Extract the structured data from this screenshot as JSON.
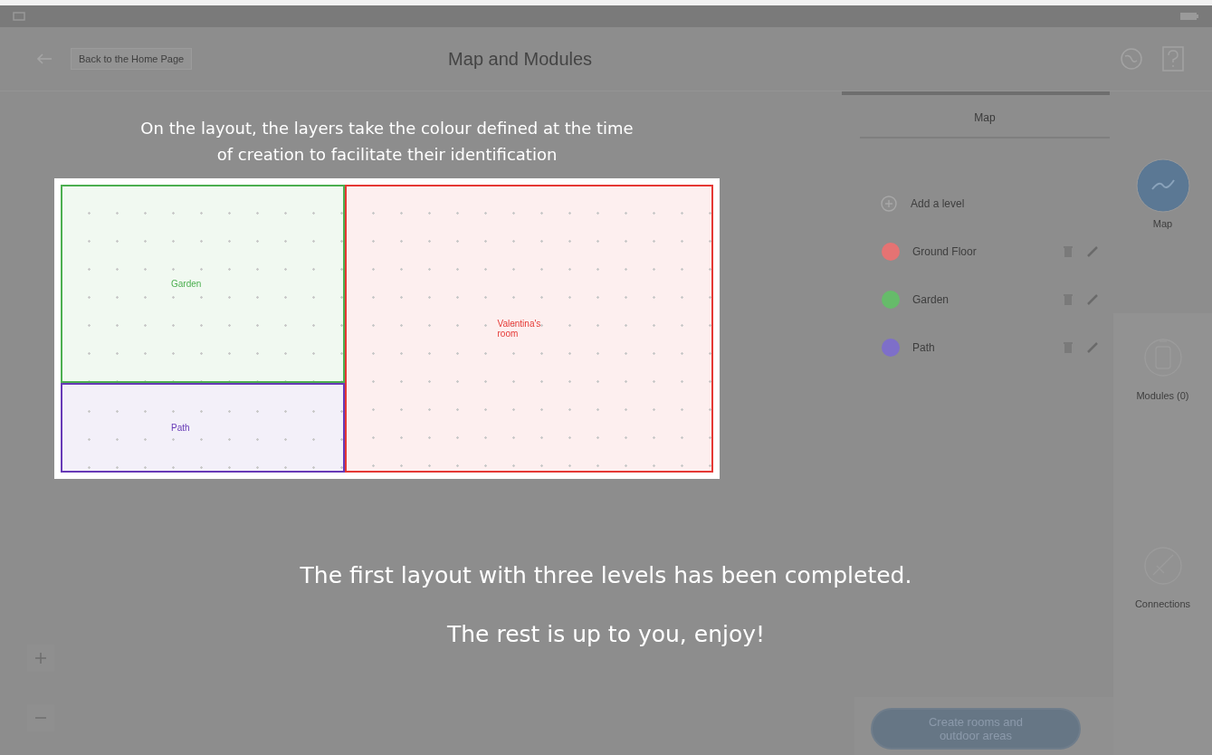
{
  "header": {
    "back_label": "Back to the Home Page",
    "title": "Map and Modules"
  },
  "panel": {
    "tabs": [
      {
        "label": "Map",
        "selected": true
      }
    ],
    "add_level": "Add a level",
    "levels": [
      {
        "name": "Ground Floor",
        "color": "#e57373"
      },
      {
        "name": "Garden",
        "color": "#66bb6a"
      },
      {
        "name": "Path",
        "color": "#7e6fc9"
      }
    ],
    "button": "Create rooms and outdoor areas"
  },
  "rail": [
    {
      "kind": "map",
      "label": "Map",
      "selected": true
    },
    {
      "kind": "modules",
      "label": "Modules (0)",
      "selected": false
    },
    {
      "kind": "connections",
      "label": "Connections",
      "selected": false
    }
  ],
  "tutorial": {
    "caption": "On the layout, the layers take the colour defined at the time of creation to facilitate their identification",
    "rooms": [
      {
        "label": "Garden",
        "color": "#4caf50"
      },
      {
        "label": "Path",
        "color": "#673ab7"
      },
      {
        "label": "Valentina's room",
        "color": "#e53935"
      }
    ],
    "messages": [
      "The first layout with three levels has been completed.",
      "The rest is up to you, enjoy!"
    ]
  }
}
